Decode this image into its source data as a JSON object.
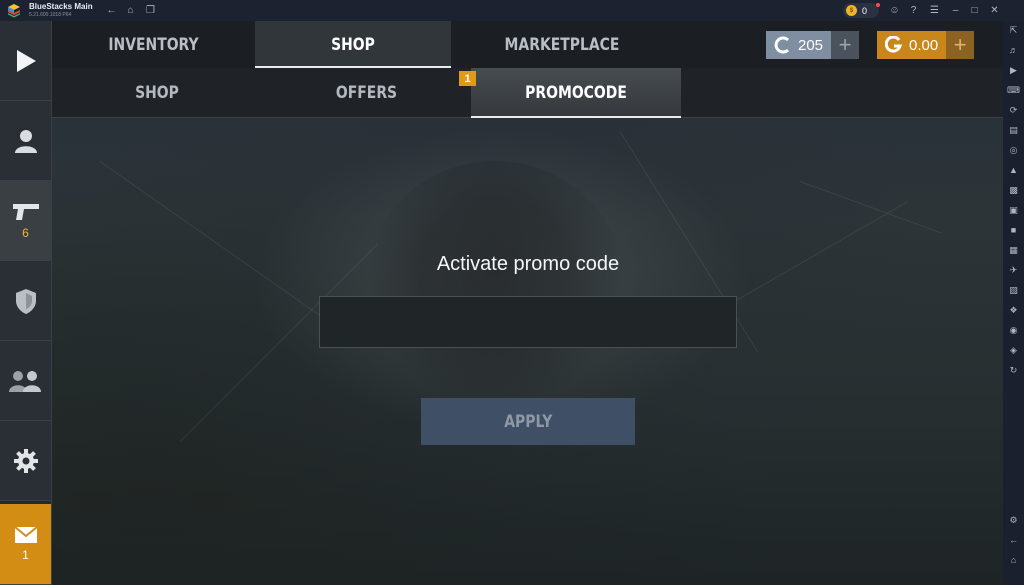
{
  "window": {
    "title": "BlueStacks Main",
    "subtitle": "5.21.600.1018  P64",
    "coin_count": "0"
  },
  "game": {
    "top_tabs": [
      {
        "label": "INVENTORY",
        "active": false
      },
      {
        "label": "SHOP",
        "active": true
      },
      {
        "label": "MARKETPLACE",
        "active": false
      }
    ],
    "currency": {
      "silver": "205",
      "gold": "0.00",
      "plus": "+"
    },
    "sub_tabs": [
      {
        "label": "SHOP",
        "active": false
      },
      {
        "label": "OFFERS",
        "active": false,
        "badge": "1"
      },
      {
        "label": "PROMOCODE",
        "active": true
      }
    ],
    "left_nav": [
      {
        "icon": "play-icon",
        "badge": ""
      },
      {
        "icon": "profile-icon",
        "badge": ""
      },
      {
        "icon": "pistol-icon",
        "badge": "6"
      },
      {
        "icon": "clan-shield-icon",
        "badge": ""
      },
      {
        "icon": "friends-icon",
        "badge": ""
      },
      {
        "icon": "settings-icon",
        "badge": ""
      },
      {
        "icon": "mail-icon",
        "badge": "1"
      }
    ],
    "promo": {
      "title": "Activate promo code",
      "input_value": "",
      "apply_label": "APPLY"
    }
  },
  "colors": {
    "accent_gold": "#d38d14",
    "silver_pill": "#7f8ea0",
    "gold_pill": "#c9861a",
    "apply_button": "#3e4f66"
  }
}
